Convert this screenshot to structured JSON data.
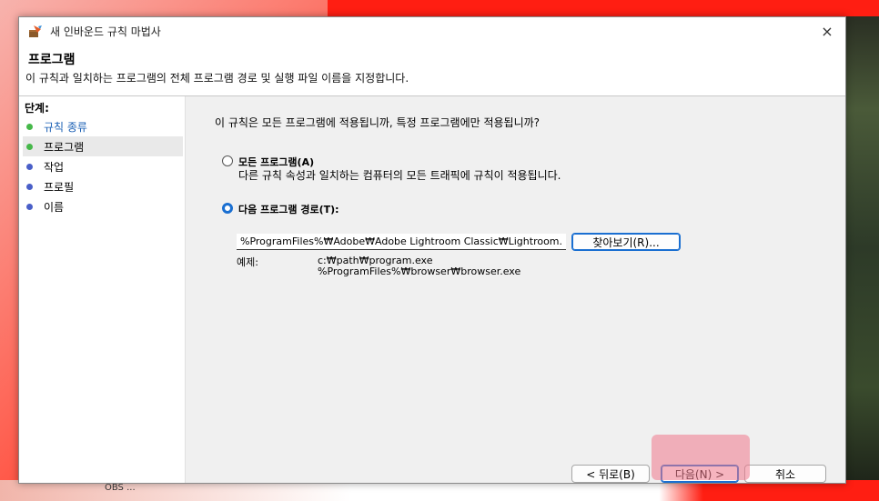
{
  "window": {
    "title": "새 인바운드 규칙 마법사",
    "close_glyph": "×"
  },
  "header": {
    "title": "프로그램",
    "subtitle": "이 규칙과 일치하는 프로그램의 전체 프로그램 경로 및 실행 파일 이름을 지정합니다."
  },
  "sidebar": {
    "heading": "단계:",
    "items": [
      {
        "label": "규칙 종류",
        "dot_color": "#46b84a",
        "text_color": "#1a5fb4"
      },
      {
        "label": "프로그램",
        "dot_color": "#46b84a",
        "text_color": "#000000"
      },
      {
        "label": "작업",
        "dot_color": "#4a5fc8",
        "text_color": "#000000"
      },
      {
        "label": "프로필",
        "dot_color": "#4a5fc8",
        "text_color": "#000000"
      },
      {
        "label": "이름",
        "dot_color": "#4a5fc8",
        "text_color": "#000000"
      }
    ]
  },
  "main": {
    "question": "이 규칙은 모든 프로그램에 적용됩니까, 특정 프로그램에만 적용됩니까?",
    "option_all": {
      "label": "모든 프로그램(A)",
      "desc": "다른 규칙 속성과 일치하는 컴퓨터의 모든 트래픽에 규칙이 적용됩니다.",
      "checked": false
    },
    "option_path": {
      "label": "다음 프로그램 경로(T):",
      "checked": true
    },
    "path_value": "%ProgramFiles%₩Adobe₩Adobe Lightroom Classic₩Lightroom.exe",
    "browse_label": "찾아보기(R)...",
    "example_label": "예제:",
    "example_lines": [
      "c:₩path₩program.exe",
      "%ProgramFiles%₩browser₩browser.exe"
    ]
  },
  "footer": {
    "back_label": "< 뒤로(B)",
    "next_label": "다음(N) >",
    "cancel_label": "취소"
  },
  "background": {
    "taskbar_text": "OBS ..."
  },
  "colors": {
    "accent": "#1a6fd1",
    "highlight": "#f0788c"
  }
}
